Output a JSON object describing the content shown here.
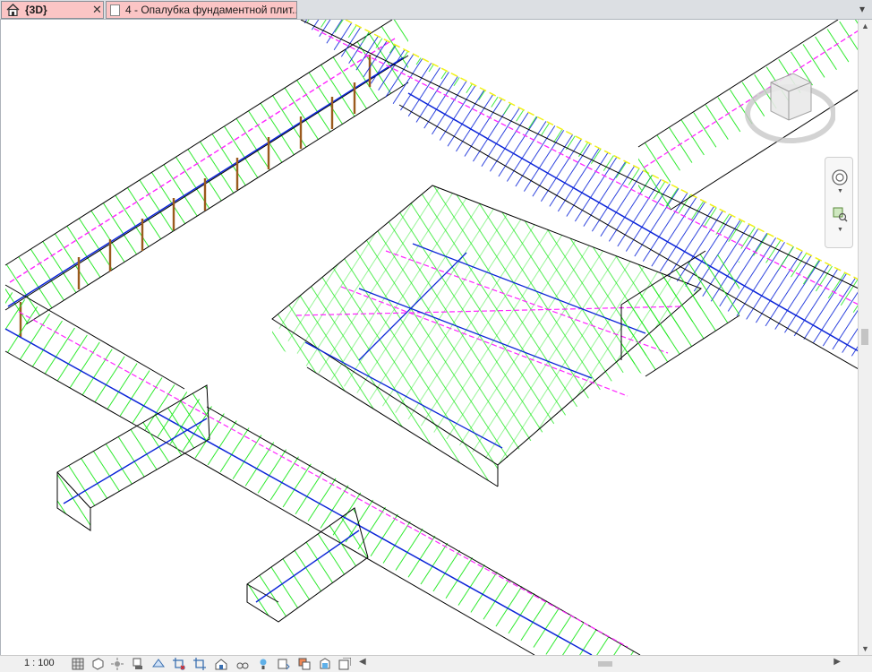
{
  "tabs": [
    {
      "label": "{3D}",
      "close": "✕"
    },
    {
      "label": "4 - Опалубка фундаментной плит..."
    }
  ],
  "tab_menu_glyph": "▾",
  "status": {
    "scale": "1 : 100"
  },
  "icons": [
    "home-icon",
    "sheet-icon",
    "detail-level-icon",
    "visual-style-icon",
    "sun-path-icon",
    "shadows-icon",
    "render-icon",
    "crop-icon",
    "hide-crop-icon",
    "unlock-view-icon",
    "temporary-hide-icon",
    "reveal-hidden-icon",
    "analytical-icon",
    "highlight-displacement-icon",
    "temporary-view-properties-icon",
    "worksharing-icon",
    "constraints-icon"
  ],
  "view": {
    "steering_wheel": "steering-wheel-icon",
    "zoom": "zoom-region-icon"
  }
}
